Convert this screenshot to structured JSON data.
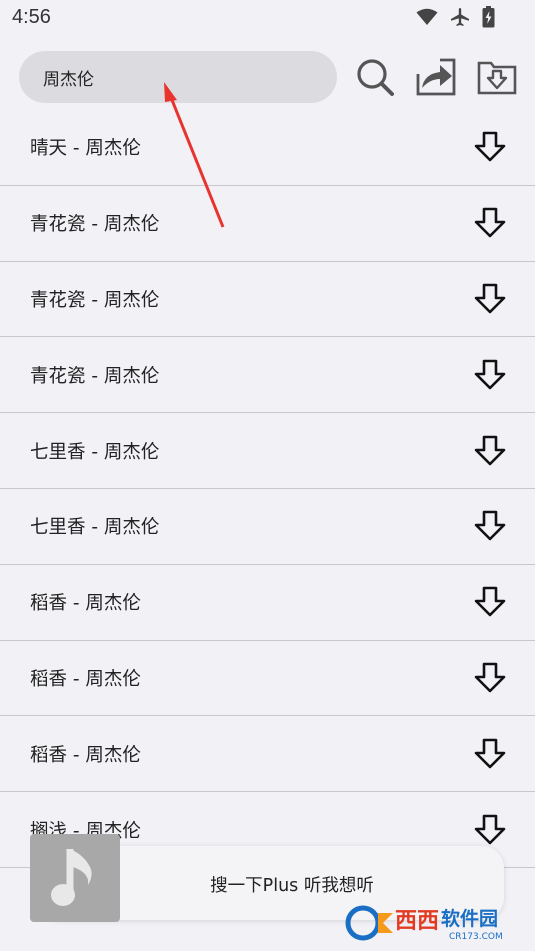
{
  "status_bar": {
    "time": "4:56",
    "icons": [
      "wifi-icon",
      "airplane-icon",
      "battery-icon"
    ]
  },
  "search": {
    "value": "周杰伦",
    "placeholder": ""
  },
  "toolbar": {
    "icons": [
      "search-icon",
      "share-icon",
      "download-folder-icon"
    ]
  },
  "songs": [
    {
      "title": "晴天 - 周杰伦"
    },
    {
      "title": "青花瓷 - 周杰伦"
    },
    {
      "title": "青花瓷 - 周杰伦"
    },
    {
      "title": "青花瓷 - 周杰伦"
    },
    {
      "title": "七里香 - 周杰伦"
    },
    {
      "title": "七里香 - 周杰伦"
    },
    {
      "title": "稻香 - 周杰伦"
    },
    {
      "title": "稻香 - 周杰伦"
    },
    {
      "title": "稻香 - 周杰伦"
    },
    {
      "title": "搁浅 - 周杰伦"
    }
  ],
  "player": {
    "title": "搜一下Plus 听我想听"
  },
  "watermark": {
    "brand": "西西软件园",
    "domain": "CR173.COM"
  },
  "colors": {
    "background": "#f2f1f6",
    "search_bg": "#dcdce0",
    "annotation_arrow": "#e8332f",
    "watermark_blue": "#1a6fc4"
  }
}
